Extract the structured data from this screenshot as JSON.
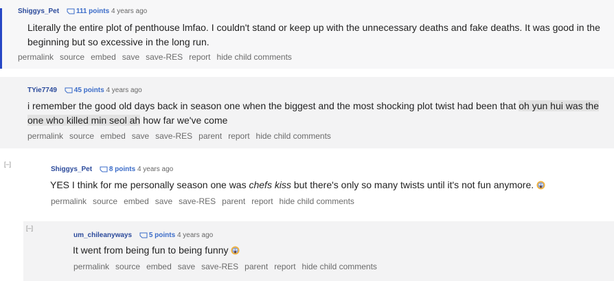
{
  "comments": [
    {
      "author": "Shiggys_Pet",
      "points": "111 points",
      "time": "4 years ago",
      "text": "Literally the entire plot of penthouse lmfao. I couldn't stand or keep up with the unnecessary deaths and fake deaths. It was good in the beginning but so excessive in the long run.",
      "buttons": [
        "permalink",
        "source",
        "embed",
        "save",
        "save-RES",
        "report",
        "hide child comments"
      ]
    },
    {
      "author": "TYie7749",
      "points": "45 points",
      "time": "4 years ago",
      "text_before": "i remember the good old days back in season one when the biggest and the most shocking plot twist had been that ",
      "text_highlight": "oh yun hui was the one who killed min seol ah",
      "text_after": " how far we've come",
      "buttons": [
        "permalink",
        "source",
        "embed",
        "save",
        "save-RES",
        "parent",
        "report",
        "hide child comments"
      ]
    },
    {
      "author": "Shiggys_Pet",
      "points": "8 points",
      "time": "4 years ago",
      "text_before": "YES I think for me personally season one was ",
      "text_em": "chefs kiss",
      "text_after": " but there's only so many twists until it's not fun anymore.",
      "emoji": "screaming-face-icon",
      "collapse": "[–]",
      "buttons": [
        "permalink",
        "source",
        "embed",
        "save",
        "save-RES",
        "parent",
        "report",
        "hide child comments"
      ]
    },
    {
      "author": "um_chileanyways",
      "points": "5 points",
      "time": "4 years ago",
      "text": "It went from being fun to being funny",
      "emoji": "screaming-face-icon",
      "collapse": "[–]",
      "buttons": [
        "permalink",
        "source",
        "embed",
        "save",
        "save-RES",
        "parent",
        "report",
        "hide child comments"
      ]
    }
  ],
  "colors": {
    "author": "#2b4a9b",
    "points": "#3a6bc8",
    "bar": "#2747c5"
  }
}
